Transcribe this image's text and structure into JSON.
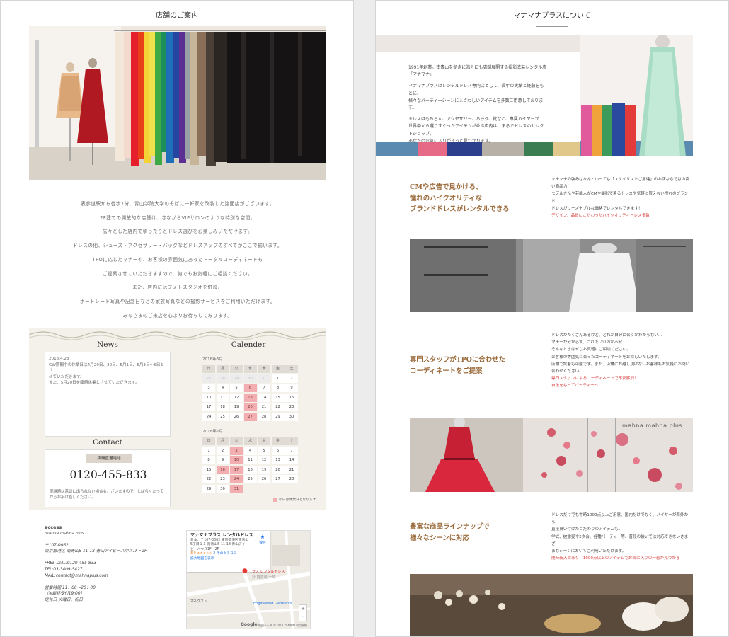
{
  "left_panel": {
    "title": "店舗のご案内",
    "intro_lines": [
      "表参道駅から徒歩7分、青山学院大学のそばに一軒家を改装した路面店がございます。",
      "2F建ての開放的な店舗は、さながらVIPサロンのような特別な空間。",
      "広々とした店内でゆったりとドレス選びをお楽しみいただけます。",
      "ドレスの他、シューズ・アクセサリー・バッグなどドレスアップのすべてがここで揃います。",
      "TPOに応じたマナーや、お客様の雰囲気にあったトータルコーディネートも",
      "ご提案させていただきますので、何でもお気軽にご相談ください。",
      "また、店内にはフォトスタジオを併設。",
      "ポートレート写真や記念日などの家族写真などの撮影サービスをご利用いただけます。",
      "みなさまのご来店を心よりお待ちしております。"
    ],
    "news": {
      "title": "News",
      "date": "2018.4.23",
      "lines": [
        "GW期間中の休業日は4月29日、30日、5月1日、5月3日～5日とさ",
        "せていただきます。",
        "また、5月20日を臨時休業とさせていただきます。"
      ]
    },
    "contact": {
      "title": "Contact",
      "badge": "店舗直通電話",
      "phone": "0120-455-833",
      "note": "混雑時は電話に出られない場合もございますので、しばらくたってからお掛け直しください。"
    },
    "calendar": {
      "title": "Calender",
      "weekdays": [
        "日",
        "月",
        "火",
        "水",
        "木",
        "金",
        "土"
      ],
      "months": [
        {
          "label": "2018年6月",
          "cells": [
            "27",
            "28",
            "29",
            "30",
            "31",
            "1",
            "2",
            "3",
            "4",
            "5",
            "6",
            "7",
            "8",
            "9",
            "10",
            "11",
            "12",
            "13",
            "14",
            "15",
            "16",
            "17",
            "18",
            "19",
            "20",
            "21",
            "22",
            "23",
            "24",
            "25",
            "26",
            "27",
            "28",
            "29",
            "30"
          ],
          "empty": [
            0,
            1,
            2,
            3,
            4
          ],
          "closed": [
            10,
            17,
            24,
            31
          ]
        },
        {
          "label": "2018年7月",
          "cells": [
            "1",
            "2",
            "3",
            "4",
            "5",
            "6",
            "7",
            "8",
            "9",
            "10",
            "11",
            "12",
            "13",
            "14",
            "15",
            "16",
            "17",
            "18",
            "19",
            "20",
            "21",
            "22",
            "23",
            "24",
            "25",
            "26",
            "27",
            "28",
            "29",
            "30",
            "31"
          ],
          "empty": [],
          "closed": [
            2,
            9,
            15,
            16,
            23,
            30
          ]
        }
      ],
      "legend": "の日は休業日となります"
    },
    "access": {
      "title": "access",
      "name": "mahna mahna plus",
      "postal": "〒107-0062",
      "address": "東京都港区 南青山5-11-18 青山アイビーハウス1F・2F",
      "free_dial": "FREE DIAL:0120-455-833",
      "tel": "TEL:03-3409-5427",
      "mail": "MAIL:contact@mahnaplus.com",
      "hours": "営業時間 11：00～20：00",
      "last": "（※最終受付19:00）",
      "holiday": "定休日 火曜日、祝日"
    },
    "map": {
      "place_name": "マナマナプラス レンタルドレス",
      "addr1": "日本、〒107-0062 東京都港区南青山",
      "addr2": "5丁目１１ 南青山5-11-18 青山アイ",
      "addr3": "ビーハウス1F・2F",
      "rating": "3.0",
      "stars": "★★★☆☆",
      "reviews": "2 件のクチコミ",
      "bigger": "拡大地図を表示",
      "save": "保存",
      "pin_label": "ラス レンタルドレス",
      "pin_sub": "計 貸衣装/一時",
      "shop_label": "Engineered Garments",
      "other_label": "スネクスト",
      "google": "Google",
      "footer": "地図データ ©2018 ZENRIN  利用規約",
      "zoom_in": "+",
      "zoom_out": "−"
    }
  },
  "right_panel": {
    "title": "マナマナプラスについて",
    "hero_paragraphs": [
      [
        "1991年創業。南青山を拠点に海外にも店舗展開する撮影衣装レンタル店「マナマナ」"
      ],
      [
        "マナマナプラスはレンタルドレス専門店として、長年の実績と経験をもとに、",
        "様々なパーティーシーンにふさわしいアイテムを多数ご用意しております。"
      ],
      [
        "ドレスはもちろん、アクセサリー、バッグ、靴など、専属バイヤーが",
        "世界中から選りすぐったアイテムが並ぶ店内は、まるでドレスのセレクトショップ。",
        "あなたのお気に入りがきっと見つかります。"
      ]
    ],
    "features": [
      {
        "heading": [
          "CMや広告で見かける、",
          "憧れのハイクオリティな",
          "ブランドドレスがレンタルできる"
        ],
        "body": [
          "マナマナの強みはなんといっても「スタイリストご用達」のお店ならではの高",
          "い商品力！",
          "モデルさんや芸能人がCMや撮影で着るドレスや気軽に買えない憧れのブランド",
          "ドレスがリーズナブルな価格でレンタルできます！"
        ],
        "highlight": [
          "デザイン、品質にこだわったハイクオリティドレス多数"
        ]
      },
      {
        "heading": [
          "専門スタッフがTPOに合わせた",
          "コーディネートをご提案"
        ],
        "body": [
          "ドレスがたくさんあるけど、どれが自分に合うかわからない…",
          "マナーが分からず、これでいいのか不安…",
          "そんなときはぜひお気軽にご相談ください。",
          "お客様の雰囲気に合ったコーディネートをお探しいたします。",
          "店舗で試着も可能です。また、店舗にお越し頂けないお客様もお気軽にお問い",
          "合わせください。"
        ],
        "highlight": [
          "専門スタッフによるコーディネートで不安解消！",
          "自信をもってパーティーへ"
        ]
      },
      {
        "heading": [
          "豊富な商品ラインナップで",
          "様々なシーンに対応"
        ],
        "body": [
          "ドレスだけでも常時1000点以上ご用意。国内だけでなく、バイヤーが海外から",
          "直接買い付けたこだわりのアイテムも。",
          "学式、披露宴や2次会、各種パーティー等、普段の装いでは対応できないさまざ",
          "まなシーンにおいてご利用いただけます。"
        ],
        "highlight": [
          "随時新入荷あり！1000点以上のアイテムでお気に入りの一着が見つかる"
        ]
      }
    ],
    "shop_sign": "mahna mahna plus"
  },
  "colors": {
    "accent_brown": "#9b6b3b",
    "highlight_red": "#d83a3a",
    "closed_pink": "#f2aeb0",
    "info_bg": "#f4f0ea"
  }
}
